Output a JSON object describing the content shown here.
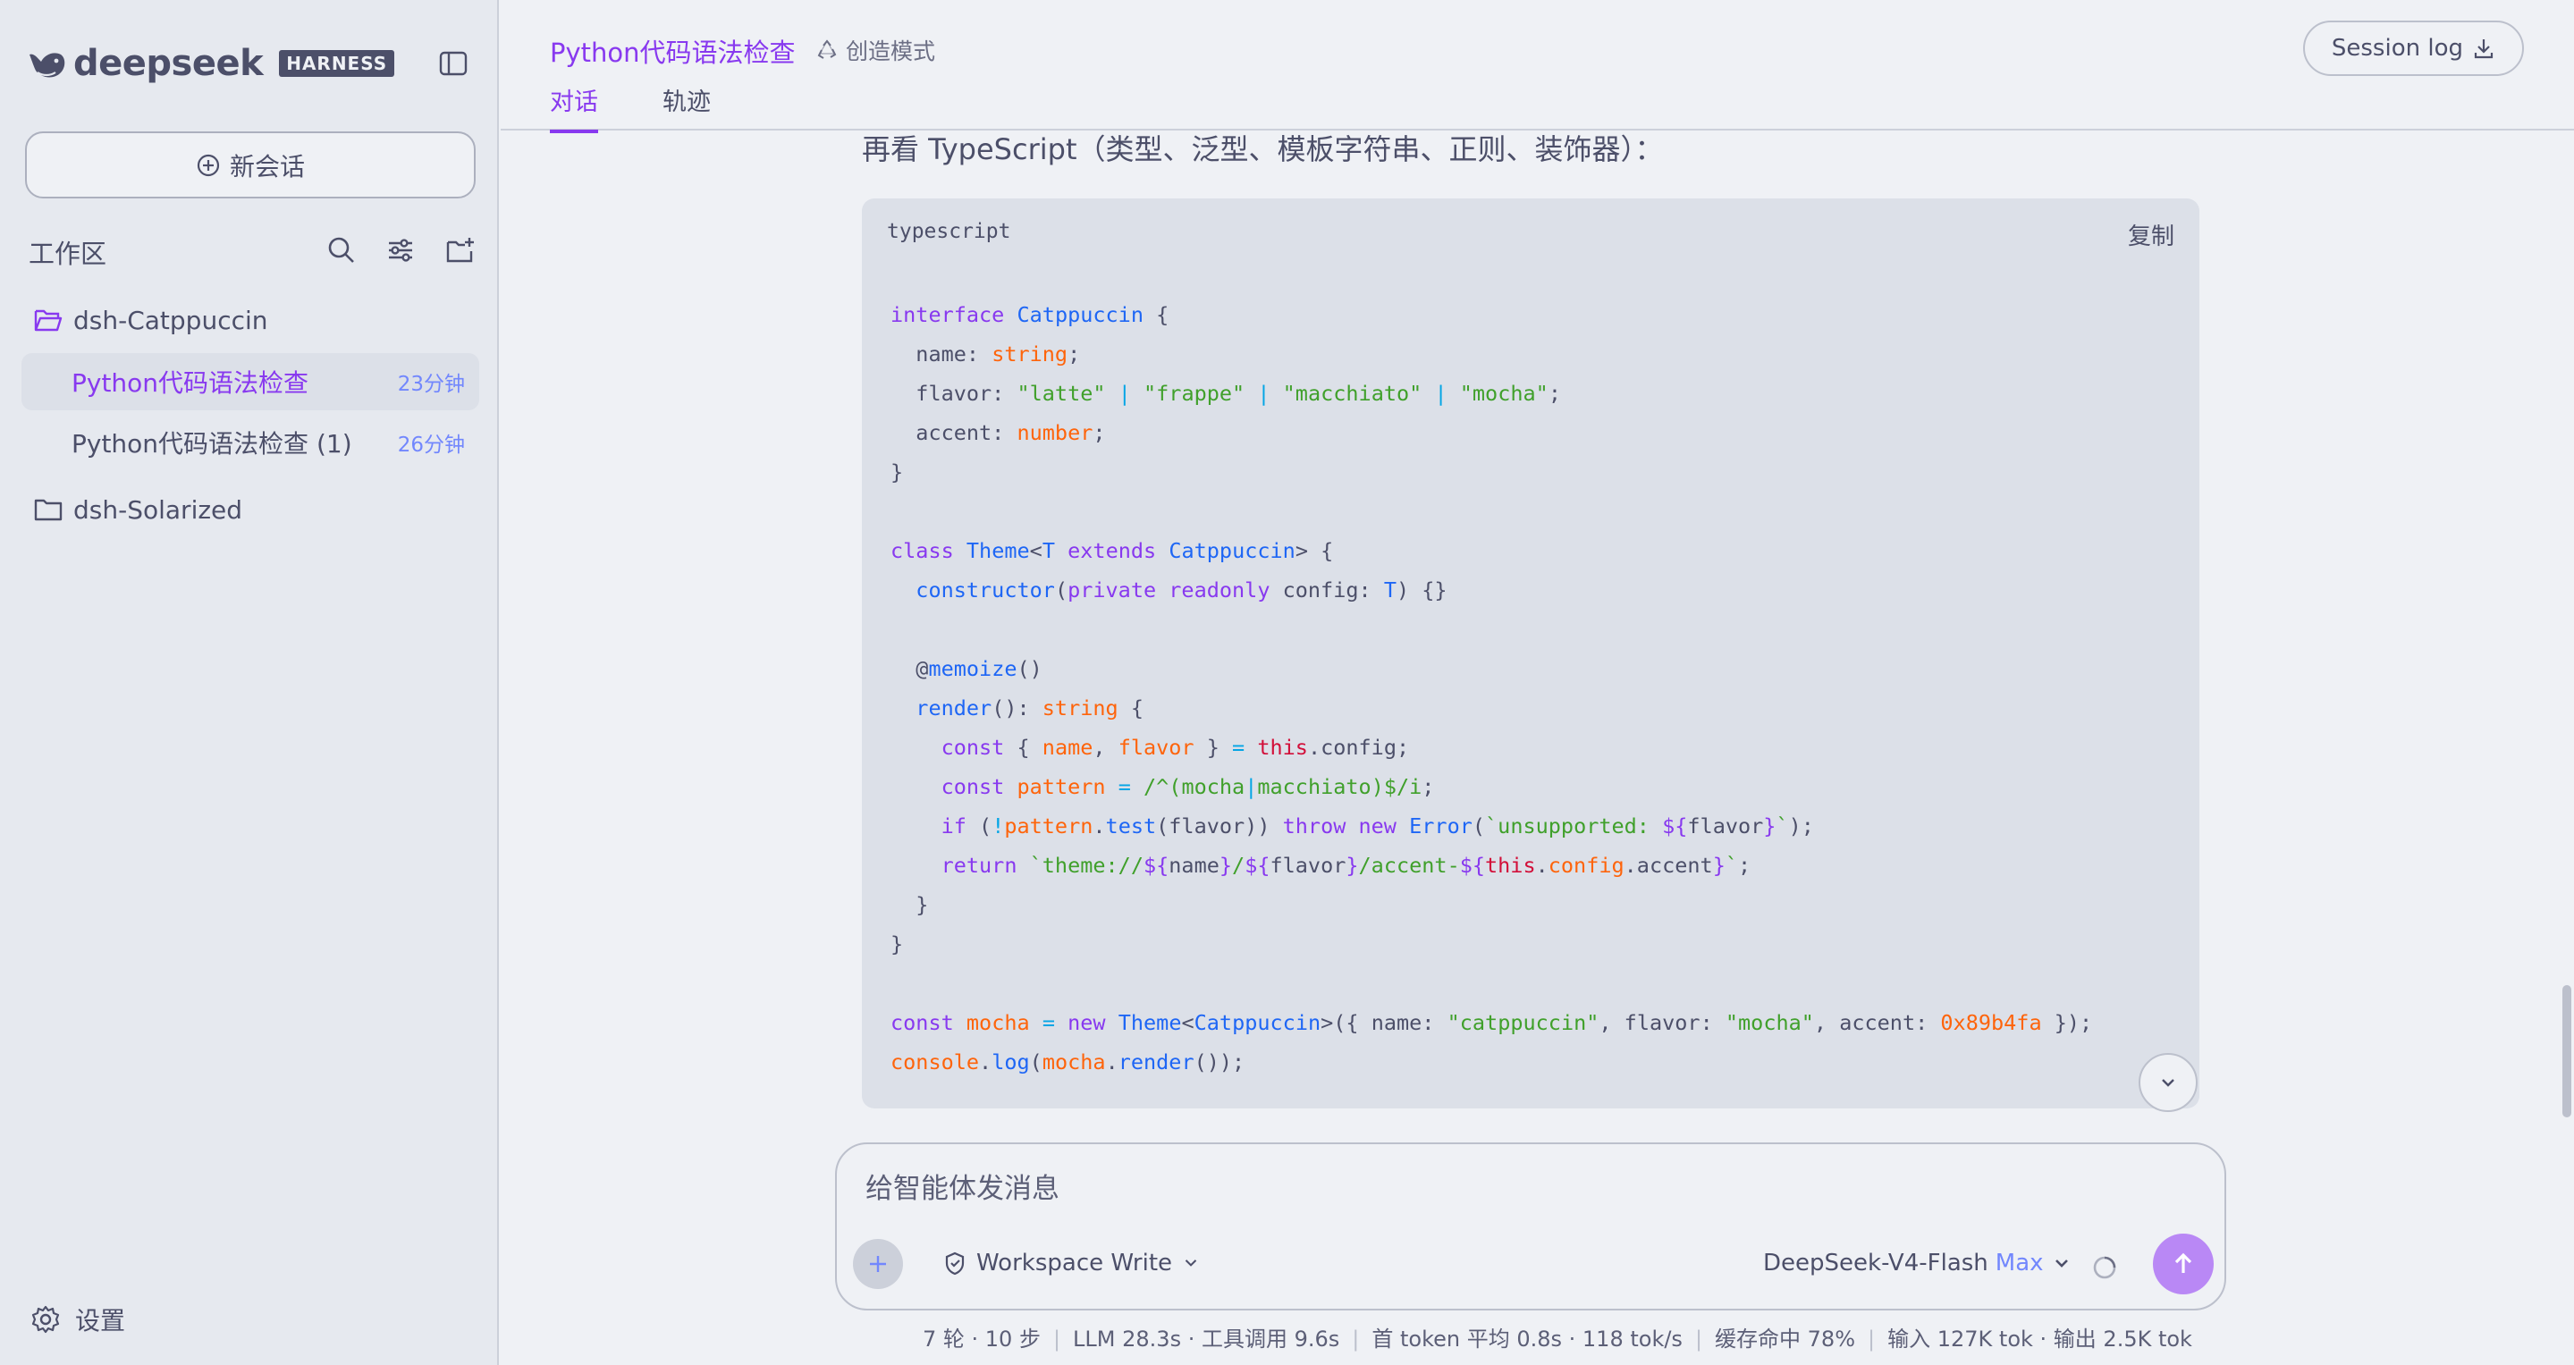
{
  "brand": {
    "name": "deepseek",
    "badge": "HARNESS"
  },
  "sidebar": {
    "new_chat_label": "新会话",
    "workspace_title": "工作区",
    "folders": [
      {
        "name": "dsh-Catppuccin",
        "sessions": [
          {
            "title": "Python代码语法检查",
            "age": "23分钟",
            "active": true
          },
          {
            "title": "Python代码语法检查 (1)",
            "age": "26分钟",
            "active": false
          }
        ]
      },
      {
        "name": "dsh-Solarized",
        "sessions": []
      }
    ],
    "settings_label": "设置"
  },
  "topbar": {
    "chat_title": "Python代码语法检查",
    "mode_label": "创造模式",
    "tabs": [
      "对话",
      "轨迹"
    ],
    "active_tab": "对话",
    "session_log_label": "Session log"
  },
  "message": {
    "intro": "再看 TypeScript（类型、泛型、模板字符串、正则、装饰器）：",
    "code_lang": "typescript",
    "copy_label": "复制"
  },
  "composer": {
    "placeholder": "给智能体发消息",
    "permission": "Workspace Write",
    "model": "DeepSeek-V4-Flash",
    "model_tier": "Max"
  },
  "stats": {
    "turns": "7 轮 · 10 步",
    "llm": "LLM 28.3s · 工具调用 9.6s",
    "first_token": "首 token 平均 0.8s · 118 tok/s",
    "cache": "缓存命中 78%",
    "io": "输入 127K tok · 输出 2.5K tok"
  },
  "colors": {
    "accent": "#8839ef",
    "background": "#eff1f5",
    "sidebar_bg": "#e6e9ef",
    "code_bg": "#dce0e8",
    "send_button": "#b988f5",
    "age_text": "#7287fd"
  }
}
